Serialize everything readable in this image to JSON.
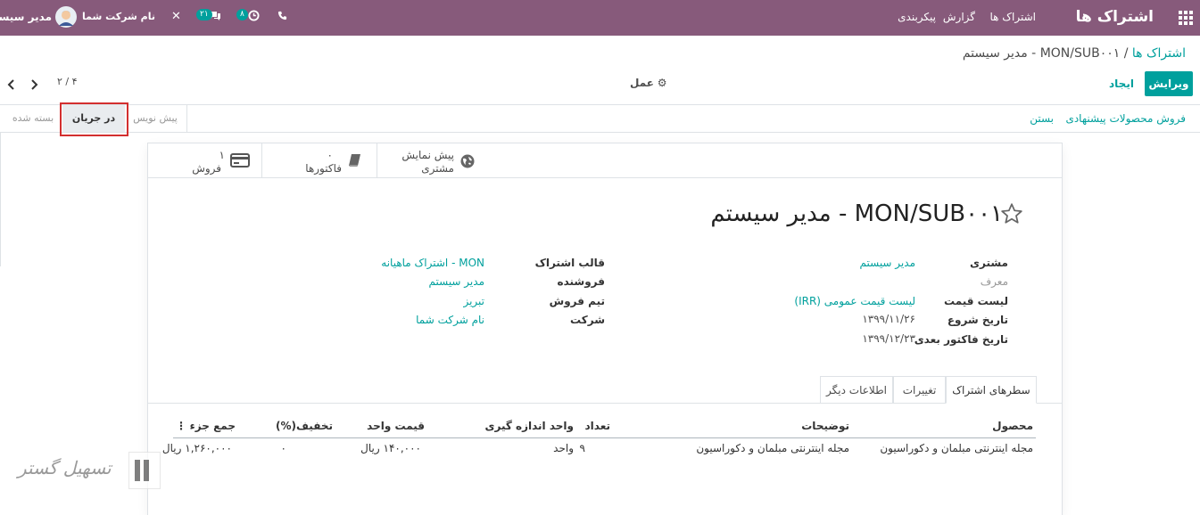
{
  "navbar": {
    "app_title": "اشتراک ها",
    "menu": [
      "اشتراک ها",
      "گزارش",
      "پیکربندی"
    ],
    "user_name": "مدیر سیستم",
    "company_name": "نام شرکت شما",
    "messages_count": "۲۱",
    "activities_count": "۸"
  },
  "breadcrumb": {
    "parent": "اشتراک ها",
    "separator": " / ",
    "current": "MON/SUB۰۰۱ - مدیر سیستم"
  },
  "controls": {
    "edit": "ویرایش",
    "create": "ایجاد",
    "action": "عمل",
    "pager": "۴ / ۲"
  },
  "statusbar": {
    "buttons": [
      "فروش محصولات پیشنهادی",
      "بستن"
    ],
    "stages": [
      "پیش نویس",
      "در جریان",
      "بسته شده"
    ],
    "active_stage": "در جریان"
  },
  "smart_buttons": {
    "preview_line1": "پیش نمایش",
    "preview_line2": "مشتری",
    "invoices_count": "۰",
    "invoices_label": "فاکتورها",
    "sales_count": "۱",
    "sales_label": "فروش"
  },
  "record": {
    "title": "MON/SUB۰۰۱ - مدیر سیستم",
    "left_fields": [
      {
        "label": "مشتری",
        "value": "مدیر سیستم"
      },
      {
        "label": "معرف",
        "value": ""
      },
      {
        "label": "لیست قیمت",
        "value": "لیست قیمت عمومی (IRR)"
      },
      {
        "label": "تاریخ شروع",
        "value": "۱۳۹۹/۱۱/۲۶"
      },
      {
        "label": "تاریخ فاکتور بعدی",
        "value": "۱۳۹۹/۱۲/۲۳"
      }
    ],
    "right_fields": [
      {
        "label": "قالب اشتراک",
        "value": "MON - اشتراک ماهیانه"
      },
      {
        "label": "فروشنده",
        "value": "مدیر سیستم"
      },
      {
        "label": "تیم فروش",
        "value": "تبریز"
      },
      {
        "label": "شرکت",
        "value": "نام شرکت شما"
      }
    ]
  },
  "tabs": [
    "سطرهای اشتراک",
    "تغییرات",
    "اطلاعات دیگر"
  ],
  "table": {
    "headers": [
      "محصول",
      "توضیحات",
      "تعداد",
      "واحد اندازه گیری",
      "قیمت واحد",
      "تخفیف(%)",
      "جمع جزء"
    ],
    "row": [
      "مجله اینترنتی مبلمان و دکوراسیون",
      "مجله اینترنتی مبلمان و دکوراسیون",
      "۹",
      "واحد",
      "۱۴۰,۰۰۰ ریال",
      "۰",
      "۱,۲۶۰,۰۰۰ ریال"
    ]
  },
  "watermark": "تسهیل گستر",
  "colors": {
    "brand": "#875a7b",
    "accent": "#00a09d",
    "highlight": "#d32f2f"
  },
  "icons": [
    "apps-grid-icon",
    "phone-icon",
    "clock-icon",
    "chat-icon",
    "tools-icon",
    "avatar",
    "gear-icon",
    "chevron-left-icon",
    "chevron-right-icon",
    "globe-icon",
    "book-icon",
    "credit-card-icon",
    "star-icon",
    "kebab-menu-icon"
  ]
}
